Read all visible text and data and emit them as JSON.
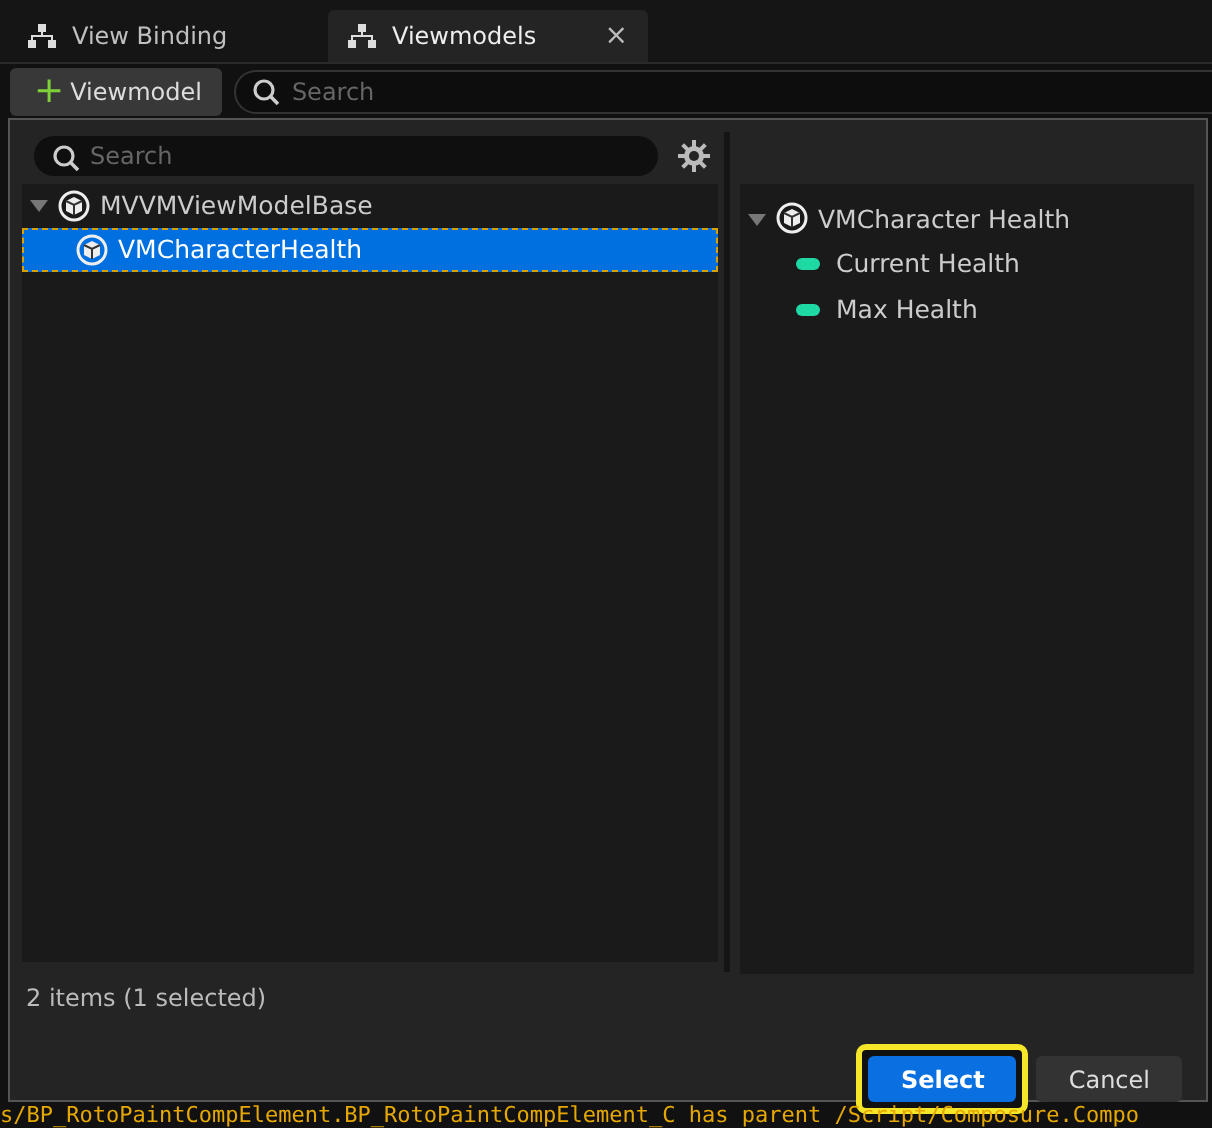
{
  "tabs": [
    {
      "label": "View Binding",
      "selected": false,
      "closable": false
    },
    {
      "label": "Viewmodels",
      "selected": true,
      "closable": true
    }
  ],
  "close_symbol": "×",
  "toolbar": {
    "add_button": {
      "symbol": "+",
      "label": "Viewmodel"
    },
    "search": {
      "placeholder": "Search"
    }
  },
  "dialog": {
    "search": {
      "placeholder": "Search"
    },
    "class_tree": [
      {
        "label": "MVVMViewModelBase",
        "expanded": true,
        "selected": false,
        "children": [
          {
            "label": "VMCharacterHealth",
            "selected": true
          }
        ]
      }
    ],
    "status": "2 items (1 selected)",
    "details_tree": {
      "label": "VMCharacter Health",
      "expanded": true,
      "children": [
        {
          "label": "Current Health",
          "color": "#1ed9a4"
        },
        {
          "label": "Max Health",
          "color": "#1ed9a4"
        }
      ]
    },
    "buttons": [
      {
        "label": "Select",
        "kind": "primary",
        "highlighted": true
      },
      {
        "label": "Cancel",
        "kind": "secondary",
        "highlighted": false
      }
    ]
  },
  "log_line": "s/BP_RotoPaintCompElement.BP_RotoPaintCompElement_C has parent /Script/Composure.Compo"
}
